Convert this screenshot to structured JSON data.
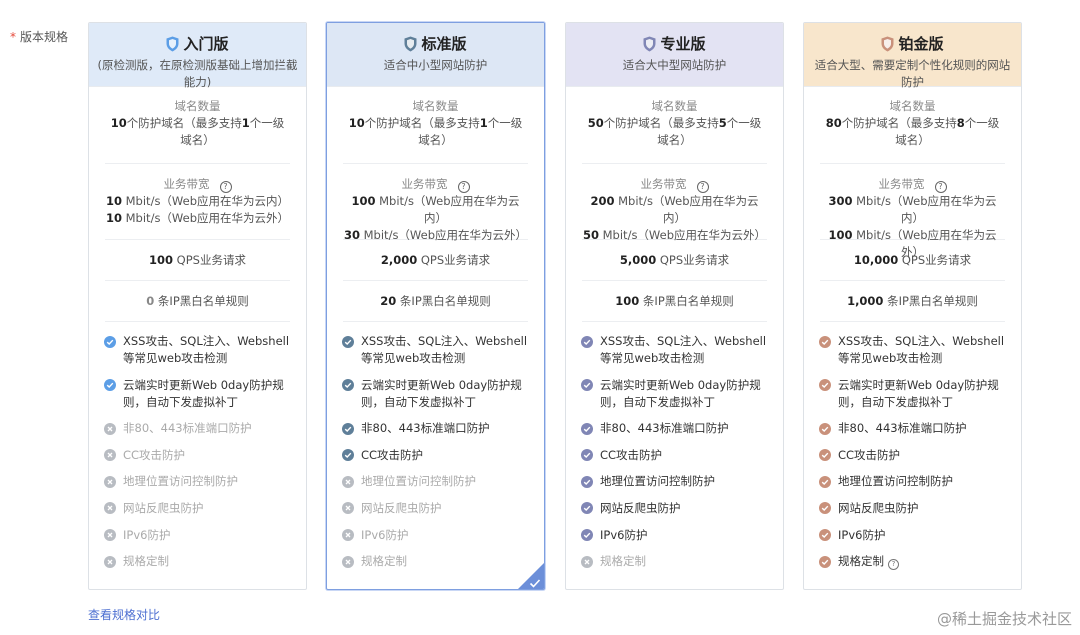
{
  "field": {
    "required_mark": "*",
    "label": "版本规格"
  },
  "plans": [
    {
      "title": "入门版",
      "subtitle": "(原检测版，在原检测版基础上增加拦截能力)",
      "head_bg": "#dfeaf8",
      "accent": "#5c9ee6",
      "domain_label": "域名数量",
      "domain_num": "10",
      "domain_text": "个防护域名（最多支持",
      "domain_num2": "1",
      "domain_text2": "个一级域名）",
      "band_label": "业务带宽",
      "band_in_num": "10",
      "band_in_text": " Mbit/s（Web应用在华为云内）",
      "band_out_num": "10",
      "band_out_text": " Mbit/s（Web应用在华为云外）",
      "qps_num": "100",
      "qps_text": " QPS业务请求",
      "ip_num": "0",
      "ip_text": " 条IP黑白名单规则",
      "ip_muted": true,
      "features": [
        {
          "text": "XSS攻击、SQL注入、Webshell等常见web攻击检测",
          "on": true
        },
        {
          "text": "云端实时更新Web 0day防护规则，自动下发虚拟补丁",
          "on": true
        },
        {
          "text": "非80、443标准端口防护",
          "on": false
        },
        {
          "text": "CC攻击防护",
          "on": false
        },
        {
          "text": "地理位置访问控制防护",
          "on": false
        },
        {
          "text": "网站反爬虫防护",
          "on": false
        },
        {
          "text": "IPv6防护",
          "on": false
        },
        {
          "text": "规格定制",
          "on": false
        }
      ]
    },
    {
      "title": "标准版",
      "subtitle": "适合中小型网站防护",
      "head_bg": "#dde7f5",
      "accent": "#5f7f99",
      "domain_label": "域名数量",
      "domain_num": "10",
      "domain_text": "个防护域名（最多支持",
      "domain_num2": "1",
      "domain_text2": "个一级域名）",
      "band_label": "业务带宽",
      "band_in_num": "100",
      "band_in_text": " Mbit/s（Web应用在华为云内）",
      "band_out_num": "30",
      "band_out_text": " Mbit/s（Web应用在华为云外）",
      "qps_num": "2,000",
      "qps_text": " QPS业务请求",
      "ip_num": "20",
      "ip_text": " 条IP黑白名单规则",
      "ip_muted": false,
      "features": [
        {
          "text": "XSS攻击、SQL注入、Webshell等常见web攻击检测",
          "on": true
        },
        {
          "text": "云端实时更新Web 0day防护规则，自动下发虚拟补丁",
          "on": true
        },
        {
          "text": "非80、443标准端口防护",
          "on": true
        },
        {
          "text": "CC攻击防护",
          "on": true
        },
        {
          "text": "地理位置访问控制防护",
          "on": false
        },
        {
          "text": "网站反爬虫防护",
          "on": false
        },
        {
          "text": "IPv6防护",
          "on": false
        },
        {
          "text": "规格定制",
          "on": false
        }
      ]
    },
    {
      "title": "专业版",
      "subtitle": "适合大中型网站防护",
      "head_bg": "#e3e3f3",
      "accent": "#8086b5",
      "domain_label": "域名数量",
      "domain_num": "50",
      "domain_text": "个防护域名（最多支持",
      "domain_num2": "5",
      "domain_text2": "个一级域名）",
      "band_label": "业务带宽",
      "band_in_num": "200",
      "band_in_text": " Mbit/s（Web应用在华为云内）",
      "band_out_num": "50",
      "band_out_text": " Mbit/s（Web应用在华为云外）",
      "qps_num": "5,000",
      "qps_text": " QPS业务请求",
      "ip_num": "100",
      "ip_text": " 条IP黑白名单规则",
      "ip_muted": false,
      "features": [
        {
          "text": "XSS攻击、SQL注入、Webshell等常见web攻击检测",
          "on": true
        },
        {
          "text": "云端实时更新Web 0day防护规则，自动下发虚拟补丁",
          "on": true
        },
        {
          "text": "非80、443标准端口防护",
          "on": true
        },
        {
          "text": "CC攻击防护",
          "on": true
        },
        {
          "text": "地理位置访问控制防护",
          "on": true
        },
        {
          "text": "网站反爬虫防护",
          "on": true
        },
        {
          "text": "IPv6防护",
          "on": true
        },
        {
          "text": "规格定制",
          "on": false
        }
      ]
    },
    {
      "title": "铂金版",
      "subtitle": "适合大型、需要定制个性化规则的网站防护",
      "head_bg": "#f8e6cc",
      "accent": "#c9917b",
      "domain_label": "域名数量",
      "domain_num": "80",
      "domain_text": "个防护域名（最多支持",
      "domain_num2": "8",
      "domain_text2": "个一级域名）",
      "band_label": "业务带宽",
      "band_in_num": "300",
      "band_in_text": " Mbit/s（Web应用在华为云内）",
      "band_out_num": "100",
      "band_out_text": " Mbit/s（Web应用在华为云外）",
      "qps_num": "10,000",
      "qps_text": " QPS业务请求",
      "ip_num": "1,000",
      "ip_text": " 条IP黑白名单规则",
      "ip_muted": false,
      "features": [
        {
          "text": "XSS攻击、SQL注入、Webshell等常见web攻击检测",
          "on": true
        },
        {
          "text": "云端实时更新Web 0day防护规则，自动下发虚拟补丁",
          "on": true
        },
        {
          "text": "非80、443标准端口防护",
          "on": true
        },
        {
          "text": "CC攻击防护",
          "on": true
        },
        {
          "text": "地理位置访问控制防护",
          "on": true
        },
        {
          "text": "网站反爬虫防护",
          "on": true
        },
        {
          "text": "IPv6防护",
          "on": true
        },
        {
          "text": "规格定制",
          "on": true,
          "help": true
        }
      ]
    }
  ],
  "selected_plan": "标准版",
  "help_glyph": "?",
  "compare_link": "查看规格对比",
  "watermark": "@稀土掘金技术社区",
  "colors": {
    "off_icon": "#b8bcc2",
    "link": "#4d6fd1",
    "required": "#e64a3b",
    "selected_border": "#7e9fe0"
  }
}
